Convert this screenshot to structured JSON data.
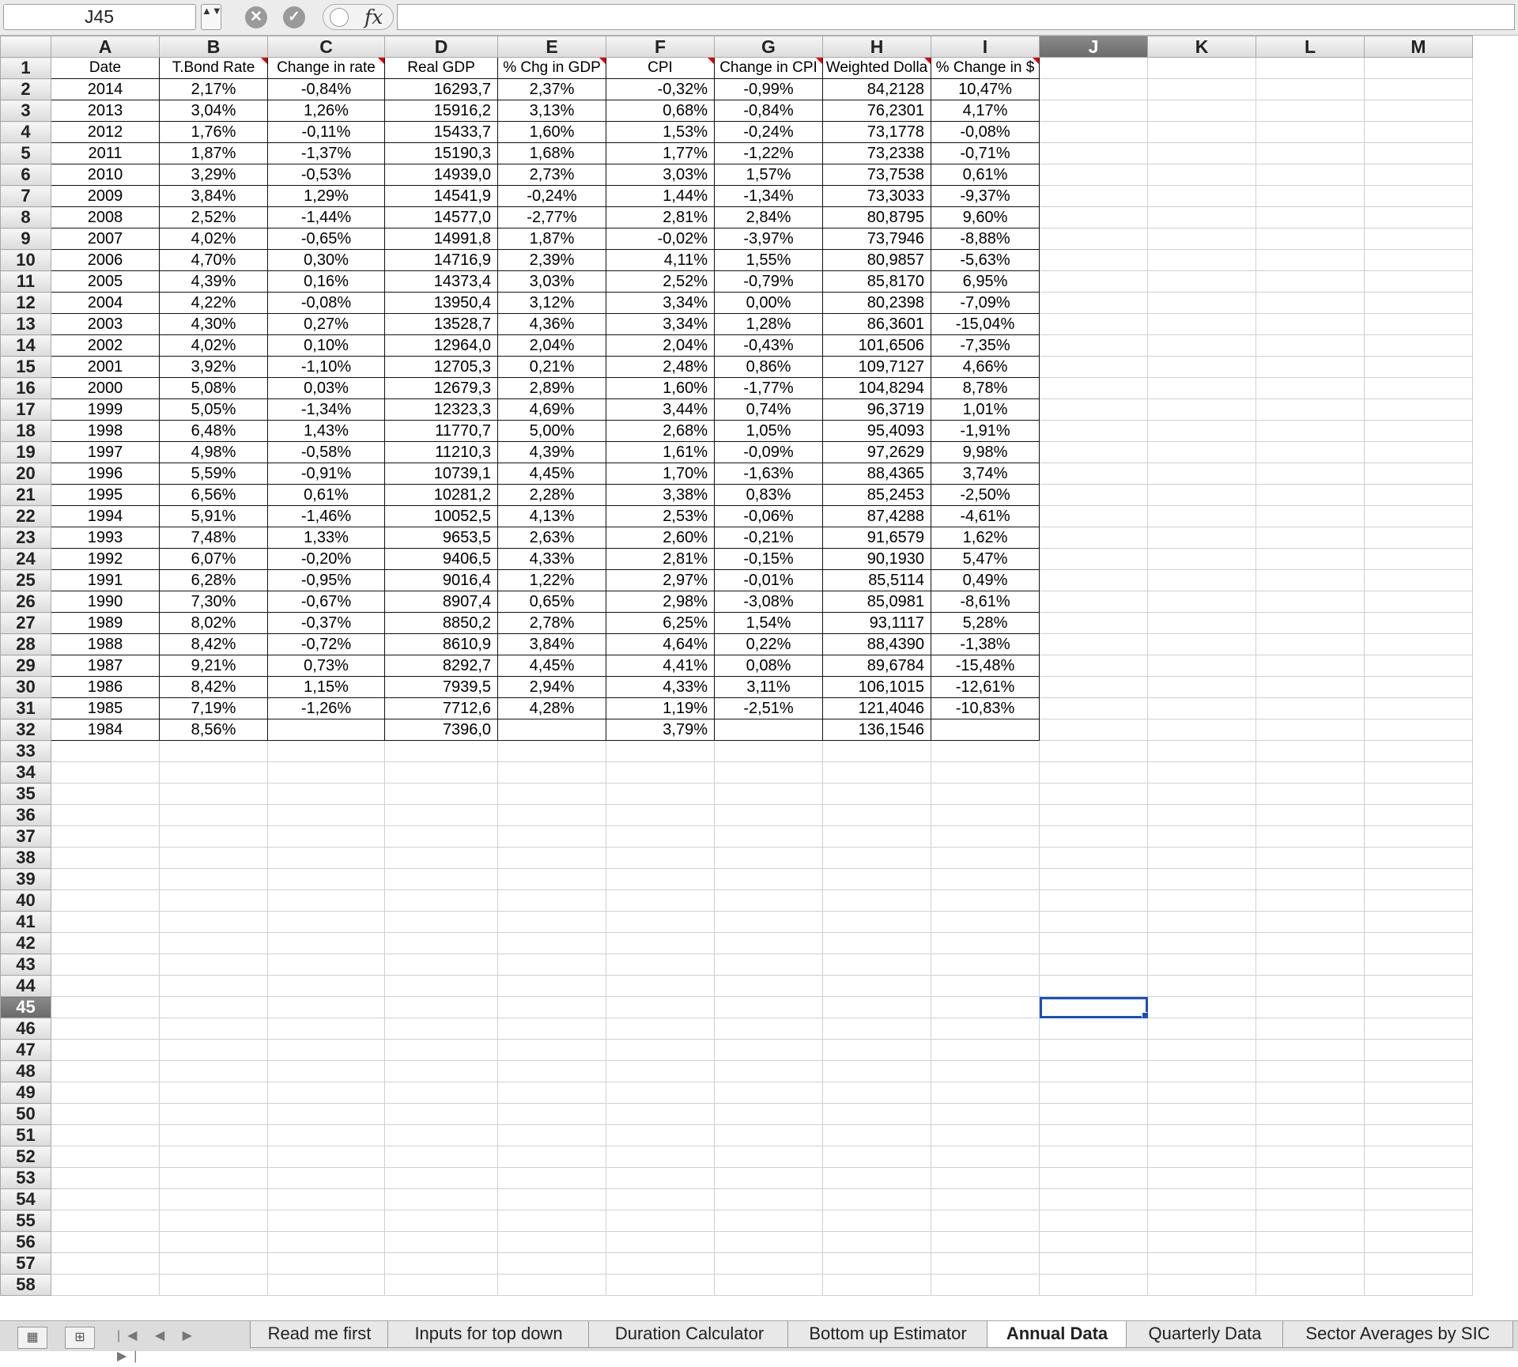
{
  "formula_bar": {
    "name_box": "J45",
    "stepper": "▲▼",
    "cancel_icon": "✕",
    "confirm_icon": "✓",
    "fx_label": "fx",
    "formula": ""
  },
  "columns": [
    "A",
    "B",
    "C",
    "D",
    "E",
    "F",
    "G",
    "H",
    "I",
    "J",
    "K",
    "L",
    "M"
  ],
  "selected_column": "J",
  "selected_row": 45,
  "headers": [
    "Date",
    "T.Bond Rate",
    "Change in rate",
    "Real GDP",
    "% Chg in GDP",
    "CPI",
    "Change in CPI",
    "Weighted Dolla",
    "% Change in $"
  ],
  "rows": [
    [
      "2014",
      "2,17%",
      "-0,84%",
      "16293,7",
      "2,37%",
      "-0,32%",
      "-0,99%",
      "84,2128",
      "10,47%"
    ],
    [
      "2013",
      "3,04%",
      "1,26%",
      "15916,2",
      "3,13%",
      "0,68%",
      "-0,84%",
      "76,2301",
      "4,17%"
    ],
    [
      "2012",
      "1,76%",
      "-0,11%",
      "15433,7",
      "1,60%",
      "1,53%",
      "-0,24%",
      "73,1778",
      "-0,08%"
    ],
    [
      "2011",
      "1,87%",
      "-1,37%",
      "15190,3",
      "1,68%",
      "1,77%",
      "-1,22%",
      "73,2338",
      "-0,71%"
    ],
    [
      "2010",
      "3,29%",
      "-0,53%",
      "14939,0",
      "2,73%",
      "3,03%",
      "1,57%",
      "73,7538",
      "0,61%"
    ],
    [
      "2009",
      "3,84%",
      "1,29%",
      "14541,9",
      "-0,24%",
      "1,44%",
      "-1,34%",
      "73,3033",
      "-9,37%"
    ],
    [
      "2008",
      "2,52%",
      "-1,44%",
      "14577,0",
      "-2,77%",
      "2,81%",
      "2,84%",
      "80,8795",
      "9,60%"
    ],
    [
      "2007",
      "4,02%",
      "-0,65%",
      "14991,8",
      "1,87%",
      "-0,02%",
      "-3,97%",
      "73,7946",
      "-8,88%"
    ],
    [
      "2006",
      "4,70%",
      "0,30%",
      "14716,9",
      "2,39%",
      "4,11%",
      "1,55%",
      "80,9857",
      "-5,63%"
    ],
    [
      "2005",
      "4,39%",
      "0,16%",
      "14373,4",
      "3,03%",
      "2,52%",
      "-0,79%",
      "85,8170",
      "6,95%"
    ],
    [
      "2004",
      "4,22%",
      "-0,08%",
      "13950,4",
      "3,12%",
      "3,34%",
      "0,00%",
      "80,2398",
      "-7,09%"
    ],
    [
      "2003",
      "4,30%",
      "0,27%",
      "13528,7",
      "4,36%",
      "3,34%",
      "1,28%",
      "86,3601",
      "-15,04%"
    ],
    [
      "2002",
      "4,02%",
      "0,10%",
      "12964,0",
      "2,04%",
      "2,04%",
      "-0,43%",
      "101,6506",
      "-7,35%"
    ],
    [
      "2001",
      "3,92%",
      "-1,10%",
      "12705,3",
      "0,21%",
      "2,48%",
      "0,86%",
      "109,7127",
      "4,66%"
    ],
    [
      "2000",
      "5,08%",
      "0,03%",
      "12679,3",
      "2,89%",
      "1,60%",
      "-1,77%",
      "104,8294",
      "8,78%"
    ],
    [
      "1999",
      "5,05%",
      "-1,34%",
      "12323,3",
      "4,69%",
      "3,44%",
      "0,74%",
      "96,3719",
      "1,01%"
    ],
    [
      "1998",
      "6,48%",
      "1,43%",
      "11770,7",
      "5,00%",
      "2,68%",
      "1,05%",
      "95,4093",
      "-1,91%"
    ],
    [
      "1997",
      "4,98%",
      "-0,58%",
      "11210,3",
      "4,39%",
      "1,61%",
      "-0,09%",
      "97,2629",
      "9,98%"
    ],
    [
      "1996",
      "5,59%",
      "-0,91%",
      "10739,1",
      "4,45%",
      "1,70%",
      "-1,63%",
      "88,4365",
      "3,74%"
    ],
    [
      "1995",
      "6,56%",
      "0,61%",
      "10281,2",
      "2,28%",
      "3,38%",
      "0,83%",
      "85,2453",
      "-2,50%"
    ],
    [
      "1994",
      "5,91%",
      "-1,46%",
      "10052,5",
      "4,13%",
      "2,53%",
      "-0,06%",
      "87,4288",
      "-4,61%"
    ],
    [
      "1993",
      "7,48%",
      "1,33%",
      "9653,5",
      "2,63%",
      "2,60%",
      "-0,21%",
      "91,6579",
      "1,62%"
    ],
    [
      "1992",
      "6,07%",
      "-0,20%",
      "9406,5",
      "4,33%",
      "2,81%",
      "-0,15%",
      "90,1930",
      "5,47%"
    ],
    [
      "1991",
      "6,28%",
      "-0,95%",
      "9016,4",
      "1,22%",
      "2,97%",
      "-0,01%",
      "85,5114",
      "0,49%"
    ],
    [
      "1990",
      "7,30%",
      "-0,67%",
      "8907,4",
      "0,65%",
      "2,98%",
      "-3,08%",
      "85,0981",
      "-8,61%"
    ],
    [
      "1989",
      "8,02%",
      "-0,37%",
      "8850,2",
      "2,78%",
      "6,25%",
      "1,54%",
      "93,1117",
      "5,28%"
    ],
    [
      "1988",
      "8,42%",
      "-0,72%",
      "8610,9",
      "3,84%",
      "4,64%",
      "0,22%",
      "88,4390",
      "-1,38%"
    ],
    [
      "1987",
      "9,21%",
      "0,73%",
      "8292,7",
      "4,45%",
      "4,41%",
      "0,08%",
      "89,6784",
      "-15,48%"
    ],
    [
      "1986",
      "8,42%",
      "1,15%",
      "7939,5",
      "2,94%",
      "4,33%",
      "3,11%",
      "106,1015",
      "-12,61%"
    ],
    [
      "1985",
      "7,19%",
      "-1,26%",
      "7712,6",
      "4,28%",
      "1,19%",
      "-2,51%",
      "121,4046",
      "-10,83%"
    ],
    [
      "1984",
      "8,56%",
      "",
      "7396,0",
      "",
      "3,79%",
      "",
      "136,1546",
      ""
    ]
  ],
  "sheet_tabs": [
    "Read me first",
    "Inputs for top down",
    "Duration Calculator",
    "Bottom up Estimator",
    "Annual Data",
    "Quarterly Data",
    "Sector Averages by SIC"
  ],
  "active_tab": "Annual Data",
  "tab_nav": "|◀ ◀ ▶ ▶|",
  "view_buttons": [
    "▦",
    "⊞"
  ]
}
